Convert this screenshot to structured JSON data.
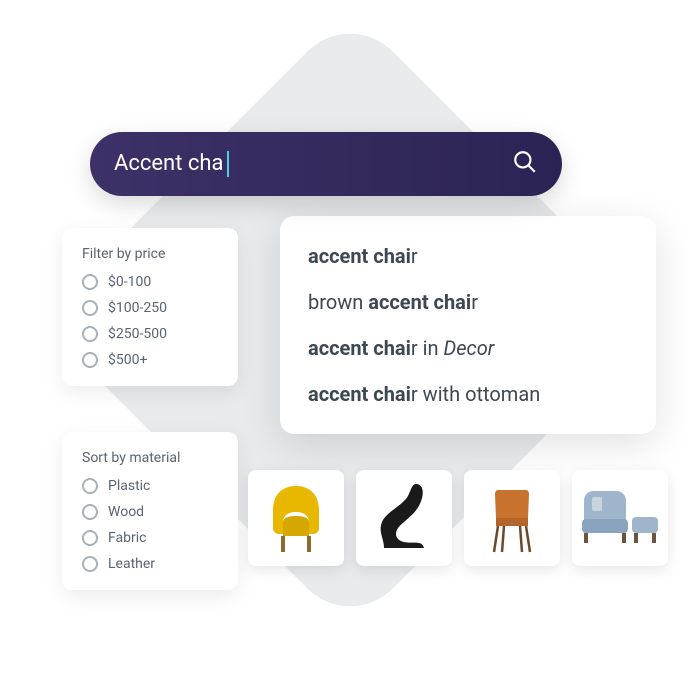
{
  "search": {
    "query": "Accent cha"
  },
  "filters": {
    "price": {
      "title": "Filter by price",
      "options": [
        "$0-100",
        "$100-250",
        "$250-500",
        "$500+"
      ]
    },
    "material": {
      "title": "Sort by material",
      "options": [
        "Plastic",
        "Wood",
        "Fabric",
        "Leather"
      ]
    }
  },
  "suggestions": [
    {
      "html": "<strong>accent chai</strong>r"
    },
    {
      "html": "brown <strong>accent chai</strong>r"
    },
    {
      "html": "<strong>accent chai</strong>r in <em>Decor</em>"
    },
    {
      "html": "<strong>accent chai</strong>r with ottoman"
    }
  ],
  "products": [
    {
      "name": "yellow-wingback-chair",
      "color": "#e8b800"
    },
    {
      "name": "black-lounge-chair",
      "color": "#1a1a1a"
    },
    {
      "name": "orange-wood-chair",
      "color": "#c7732f"
    },
    {
      "name": "blue-chair-ottoman",
      "color": "#9fb5cc"
    }
  ]
}
